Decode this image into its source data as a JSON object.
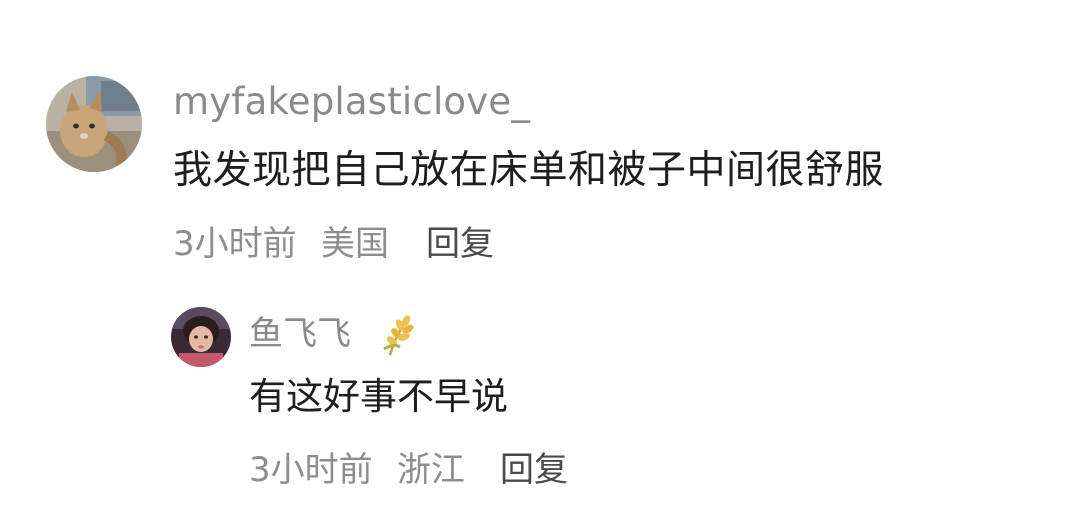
{
  "comments": [
    {
      "username": "myfakeplasticlove_",
      "text": "我发现把自己放在床单和被子中间很舒服",
      "time": "3小时前",
      "location": "美国",
      "reply_label": "回复",
      "avatar_icon": "cat-photo-avatar"
    },
    {
      "username": "鱼飞飞",
      "badge_icon": "wheat-badge-icon",
      "text": "有这好事不早说",
      "time": "3小时前",
      "location": "浙江",
      "reply_label": "回复",
      "avatar_icon": "person-photo-avatar"
    }
  ],
  "colors": {
    "username": "#8a8a8a",
    "text": "#1e1e1e",
    "meta": "#8d8d8d",
    "reply": "#4a4a4a",
    "badge_gold": "#e8b33a"
  }
}
